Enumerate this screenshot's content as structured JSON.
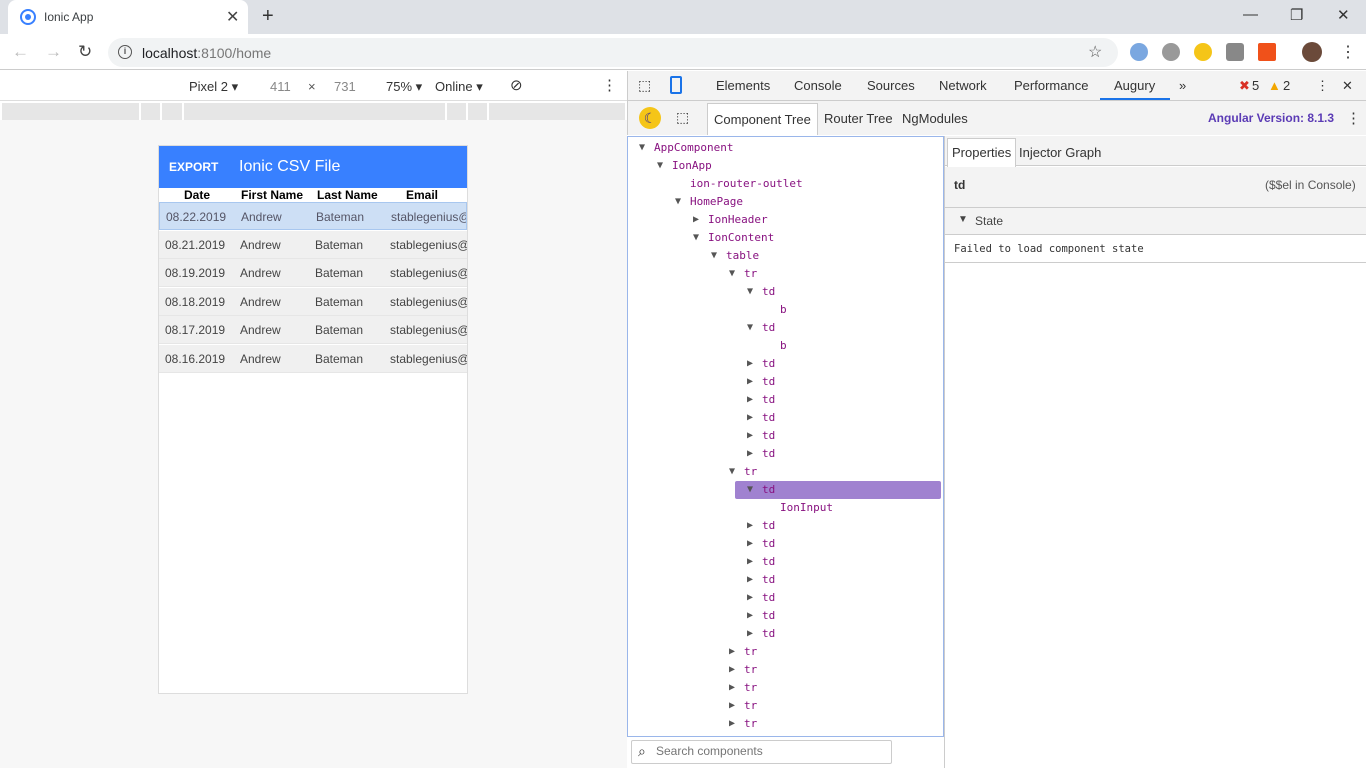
{
  "browser": {
    "tab_title": "Ionic App",
    "url_host": "localhost",
    "url_path": ":8100/home"
  },
  "device_toolbar": {
    "device": "Pixel 2",
    "width": "411",
    "times": "×",
    "height": "731",
    "zoom": "75%",
    "network": "Online"
  },
  "app": {
    "export_label": "EXPORT",
    "title": "Ionic CSV File",
    "columns": [
      "Date",
      "First Name",
      "Last Name",
      "Email"
    ],
    "rows": [
      [
        "08.22.2019",
        "Andrew",
        "Bateman",
        "stablegenius@"
      ],
      [
        "08.21.2019",
        "Andrew",
        "Bateman",
        "stablegenius@"
      ],
      [
        "08.19.2019",
        "Andrew",
        "Bateman",
        "stablegenius@"
      ],
      [
        "08.18.2019",
        "Andrew",
        "Bateman",
        "stablegenius@"
      ],
      [
        "08.17.2019",
        "Andrew",
        "Bateman",
        "stablegenius@"
      ],
      [
        "08.16.2019",
        "Andrew",
        "Bateman",
        "stablegenius@"
      ]
    ],
    "selected_row": 0,
    "accent": "#3880ff"
  },
  "devtools": {
    "tabs": [
      "Elements",
      "Console",
      "Sources",
      "Network",
      "Performance",
      "Augury"
    ],
    "active_tab": "Augury",
    "errors": "5",
    "warnings": "2"
  },
  "augury": {
    "tabs": [
      "Component Tree",
      "Router Tree",
      "NgModules"
    ],
    "angular_version": "Angular Version: 8.1.3",
    "search_placeholder": "Search components",
    "tree": [
      {
        "l": 0,
        "a": "down",
        "t": "AppComponent"
      },
      {
        "l": 1,
        "a": "down",
        "t": "IonApp"
      },
      {
        "l": 2,
        "a": "",
        "t": "ion-router-outlet"
      },
      {
        "l": 2,
        "a": "down",
        "t": "HomePage"
      },
      {
        "l": 3,
        "a": "right",
        "t": "IonHeader"
      },
      {
        "l": 3,
        "a": "down",
        "t": "IonContent"
      },
      {
        "l": 4,
        "a": "down",
        "t": "table"
      },
      {
        "l": 5,
        "a": "down",
        "t": "tr"
      },
      {
        "l": 6,
        "a": "down",
        "t": "td"
      },
      {
        "l": 7,
        "a": "",
        "t": "b"
      },
      {
        "l": 6,
        "a": "down",
        "t": "td"
      },
      {
        "l": 7,
        "a": "",
        "t": "b"
      },
      {
        "l": 6,
        "a": "right",
        "t": "td"
      },
      {
        "l": 6,
        "a": "right",
        "t": "td"
      },
      {
        "l": 6,
        "a": "right",
        "t": "td"
      },
      {
        "l": 6,
        "a": "right",
        "t": "td"
      },
      {
        "l": 6,
        "a": "right",
        "t": "td"
      },
      {
        "l": 6,
        "a": "right",
        "t": "td"
      },
      {
        "l": 5,
        "a": "down",
        "t": "tr"
      },
      {
        "l": 6,
        "a": "down",
        "t": "td",
        "sel": true
      },
      {
        "l": 7,
        "a": "",
        "t": "IonInput"
      },
      {
        "l": 6,
        "a": "right",
        "t": "td"
      },
      {
        "l": 6,
        "a": "right",
        "t": "td"
      },
      {
        "l": 6,
        "a": "right",
        "t": "td"
      },
      {
        "l": 6,
        "a": "right",
        "t": "td"
      },
      {
        "l": 6,
        "a": "right",
        "t": "td"
      },
      {
        "l": 6,
        "a": "right",
        "t": "td"
      },
      {
        "l": 6,
        "a": "right",
        "t": "td"
      },
      {
        "l": 5,
        "a": "right",
        "t": "tr"
      },
      {
        "l": 5,
        "a": "right",
        "t": "tr"
      },
      {
        "l": 5,
        "a": "right",
        "t": "tr"
      },
      {
        "l": 5,
        "a": "right",
        "t": "tr"
      },
      {
        "l": 5,
        "a": "right",
        "t": "tr"
      }
    ],
    "props_tabs": [
      "Properties",
      "Injector Graph"
    ],
    "selected_name": "td",
    "console_hint": "($$el in Console)",
    "state_label": "State",
    "state_message": "Failed to load component state"
  }
}
